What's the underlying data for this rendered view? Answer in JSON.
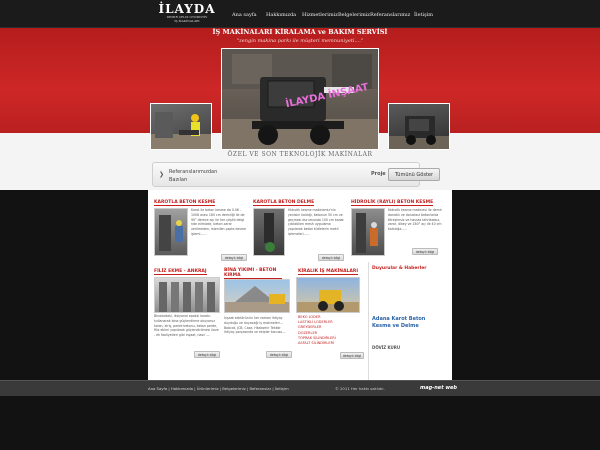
{
  "header": {
    "logo_title": "İLAYDA",
    "logo_sub_1": "DEMIR ÇELIK OTOMOTİV",
    "logo_sub_2": "İŞ MAKİNALARI",
    "nav": [
      "Ana sayfa",
      "Hakkımızda",
      "Hizmetlerimiz",
      "Belgelerimiz",
      "Referanslarımız",
      "İletişim"
    ]
  },
  "hero": {
    "title": "İŞ MAKİNALARI KİRALAMA ve BAKIM SERVİSİ",
    "slogan": "\"zengin makina parkı ile müşteri memnuniyeti....\"",
    "overlay": "İLAYDA İNŞAAT",
    "caption": "ÖZEL VE SON TEKNOLOJİK MAKİNALAR"
  },
  "references": {
    "text_line1": "Referanslarımızdan",
    "text_line2": "Bazıları",
    "proje_label": "Proje",
    "button": "Tümünü Göster"
  },
  "cards_top": [
    {
      "title": "KAROTLA BETON KESME",
      "text": "Karot ile beton kesme da 0.06 - 1008 arası 160 cm derinliği ile de 90° derece açı ile her çeşitli delgi nde elimizde, beton zarar verilmeden, istenilen çapta kesme işlemi......",
      "more": "detaylı bilgi"
    },
    {
      "title": "KAROTLA BETON DELME",
      "text": "Hidrolik kesme makinemiz'nin yenisini kaldığı, betonun 50 cm ve geçmesi durumunda 100 cm kadar çıkılabilen mesh uygulama yapılarak beton kütlelerin mekil işlemeleri......",
      "more": "detaylı bilgi"
    },
    {
      "title": "HİDROLİK (RAYLI) BETON KESME",
      "text": "Hidrolik kesme makinesi ile demir donatılı ve donatısız betonlarda titreşimsiz ve hassas tahribatsız, zarar, ölkey ve 180° açı ile 40 cm kalınlığa......",
      "more": "detaylı bilgi"
    }
  ],
  "cards_bottom": [
    {
      "title": "FİLİZ EKME - ANKRAJ",
      "text": "Binalardaki, iksiyonal epoksi karotu kullanarak bina güçlendirme okuyoruz kolon, kiriş, perde betonu, beton perde, filiz ekimi yapılarak güçlendirilmesi ilave - ek faaliyetleri gibi inşaat, nasıl ....",
      "more": "detaylı bilgi"
    },
    {
      "title": "BİNA YIKIMI - BETON KIRMA",
      "text": "İnşaat sektörünün her zaman ihtiyaç duyduğu ve duyacağı iş makineleri... Bobcat, JCB, Case, Hkakomir Tekkör ihtiyaç parçasında ve ekipler konusu....",
      "more": "detaylı bilgi"
    },
    {
      "title": "KİRALIK İŞ MAKİNALARI",
      "list": [
        "BEKO LODER",
        "LASTİKLİ LODERLER",
        "GREYDERLER",
        "DOZERLER",
        "TOPRAK SİLİNDİRLERİ",
        "ASFALT SİLİNDİRLERİ"
      ],
      "more": "detaylı bilgi"
    }
  ],
  "sidebar": {
    "section_title": "Duyurular & Haberler",
    "news_title": "Adana Karot Beton Kesme ve Delme",
    "sub_title": "DÖVİZ KURU"
  },
  "footer": {
    "links": "Ana Sayfa | Hakkımızda | Ürünlerimiz | Belgelerimiz | Referanslar | İletişim",
    "copyright": "© 2011 Her hakkı saklıdır.",
    "brand": "mag-net web"
  },
  "colors": {
    "accent": "#c41e1e",
    "hero_red": "#ce2727",
    "link_blue": "#2a63a8"
  }
}
